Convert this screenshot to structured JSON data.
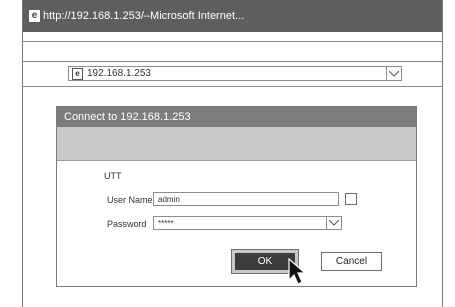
{
  "window": {
    "title": "http://192.168.1.253/–Microsoft Internet...",
    "icon": "ie-icon"
  },
  "address_bar": {
    "value": "192.168.1.253",
    "icon": "page-icon"
  },
  "dialog": {
    "title_prefix": "Connect to",
    "title_host": "192.168.1.253",
    "realm": "UTT",
    "user_label": "User Name",
    "user_value": "admin",
    "password_label": "Password",
    "password_value": "*****",
    "ok_label": "OK",
    "cancel_label": "Cancel"
  },
  "colors": {
    "titlebar": "#5e5e5e",
    "dialog_title": "#7d7d7d",
    "ok_button": "#3c3c3c"
  }
}
